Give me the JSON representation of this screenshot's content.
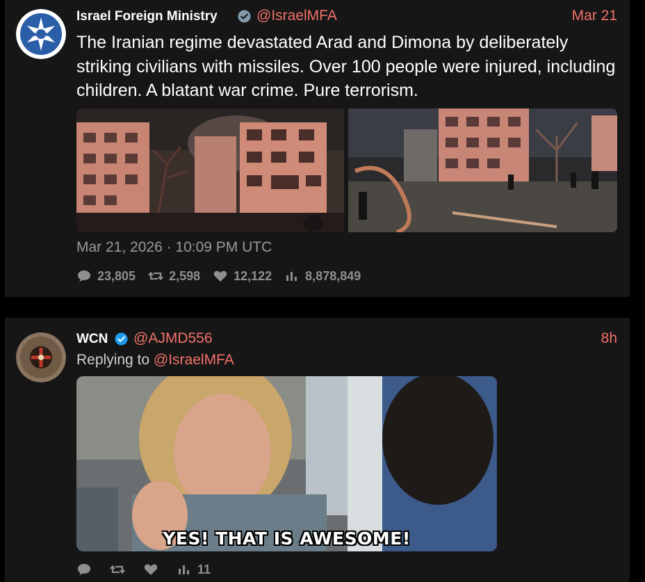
{
  "tweets": [
    {
      "author_name": "Israel Foreign Ministry",
      "verified_type": "gray",
      "handle": "@IsraelMFA",
      "date": "Mar 21",
      "text": "The Iranian regime devastated Arad and Dimona by deliberately striking civilians with missiles. Over 100 people were injured, including children. A blatant war crime. Pure terrorism.",
      "timestamp": "Mar 21, 2026 · 10:09 PM UTC",
      "stats": {
        "replies": "23,805",
        "retweets": "2,598",
        "likes": "12,122",
        "views": "8,878,849"
      },
      "media": [
        "damaged-building-night-photo",
        "damaged-building-crowd-photo"
      ]
    },
    {
      "author_name": "WCN",
      "verified_type": "blue",
      "handle": "@AJMD556",
      "date": "8h",
      "reply_prefix": "Replying to",
      "reply_to": "@IsraelMFA",
      "gif_caption": "YES! THAT IS AWESOME!",
      "stats": {
        "replies": "",
        "retweets": "",
        "likes": "",
        "views": "11"
      }
    }
  ],
  "colors": {
    "background": "#000000",
    "card": "#161616",
    "accent": "#f2726a",
    "text": "#ffffff",
    "muted": "#8f8f8f",
    "verified_blue": "#1d9bf0",
    "verified_gray": "#829aab"
  },
  "icons": [
    "reply-icon",
    "retweet-icon",
    "like-icon",
    "views-icon",
    "verified-badge-icon"
  ]
}
